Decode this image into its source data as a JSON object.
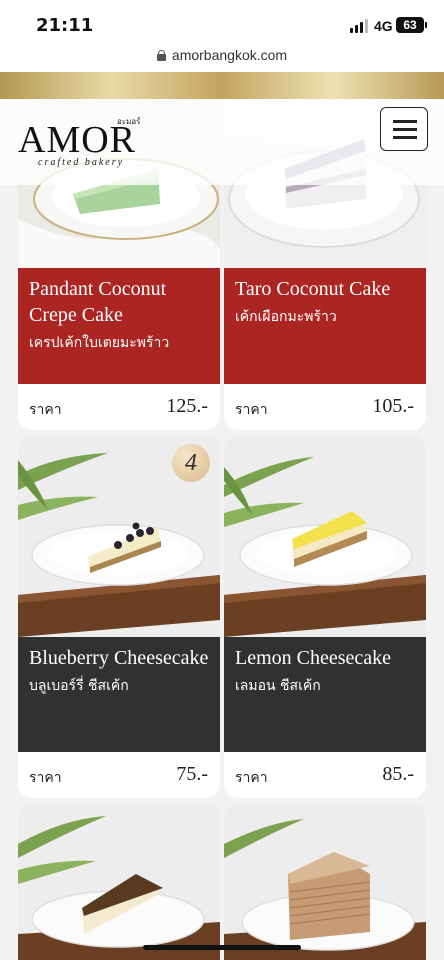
{
  "status_bar": {
    "time": "21:11",
    "network": "4G",
    "battery": "63"
  },
  "browser": {
    "url": "amorbangkok.com"
  },
  "header": {
    "logo_text": "AMOR",
    "logo_thai": "อะมอร์",
    "logo_tagline": "crafted bakery",
    "menu_icon": "hamburger-menu-icon"
  },
  "products": [
    {
      "name_en": "Pandant Coconut Crepe Cake",
      "name_th": "เครปเค้กใบเตยมะพร้าว",
      "price_label": "ราคา",
      "price": "125.-",
      "panel_color": "#ab2522"
    },
    {
      "name_en": "Taro Coconut Cake",
      "name_th": "เค้กเผือกมะพร้าว",
      "price_label": "ราคา",
      "price": "105.-",
      "panel_color": "#ab2522"
    },
    {
      "name_en": "Blueberry Cheesecake",
      "name_th": "บลูเบอร์รี่ ชีสเค้ก",
      "price_label": "ราคา",
      "price": "75.-",
      "panel_color": "#303131",
      "badge": "4"
    },
    {
      "name_en": "Lemon Cheesecake",
      "name_th": "เลมอน ชีสเค้ก",
      "price_label": "ราคา",
      "price": "85.-",
      "panel_color": "#303131"
    }
  ]
}
